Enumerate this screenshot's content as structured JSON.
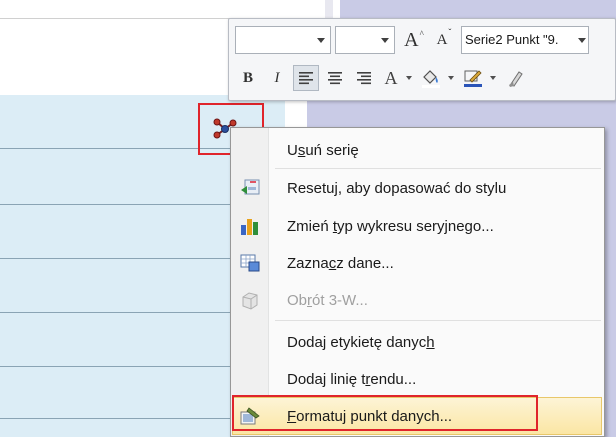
{
  "mini_toolbar": {
    "font_name": "",
    "font_size": "",
    "grow_font": "A",
    "shrink_font": "A",
    "series_selector": "Serie2 Punkt \"9.",
    "bold": "B",
    "italic": "I",
    "font_color": "A"
  },
  "context_menu": {
    "items": [
      {
        "label": "Usuń serię",
        "enabled": true,
        "icon": null
      },
      {
        "label": "Resetuj, aby dopasować do stylu",
        "enabled": true,
        "icon": "reset-style-icon"
      },
      {
        "label": "Zmień typ wykresu seryjnego...",
        "enabled": true,
        "icon": "change-chart-type-icon"
      },
      {
        "label": "Zaznacz dane...",
        "enabled": true,
        "icon": "select-data-icon"
      },
      {
        "label": "Obrót 3-W...",
        "enabled": false,
        "icon": "rotation-3d-icon"
      },
      {
        "label": "Dodaj etykietę danych",
        "enabled": true,
        "icon": null
      },
      {
        "label": "Dodaj linię trendu...",
        "enabled": true,
        "icon": null
      },
      {
        "label": "Formatuj punkt danych...",
        "enabled": true,
        "icon": "format-data-point-icon",
        "highlighted": true
      }
    ]
  },
  "colors": {
    "highlight_border": "#e0242b",
    "plot_area": "#dcedf6",
    "menu_hover": "#fbe6a4"
  }
}
